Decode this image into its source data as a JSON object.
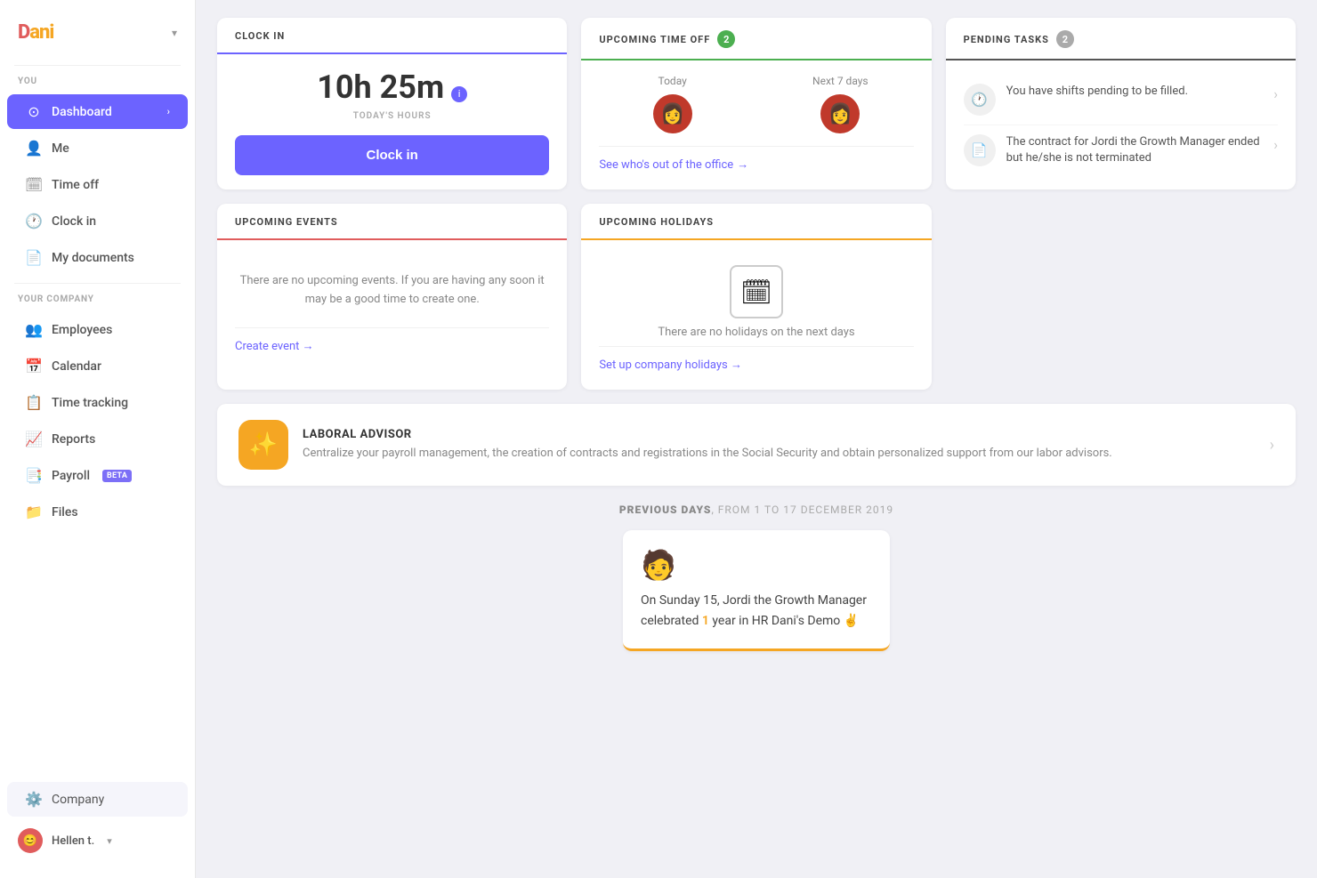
{
  "sidebar": {
    "logo": "Dani",
    "you_label": "YOU",
    "your_company_label": "YOUR COMPANY",
    "items_you": [
      {
        "id": "dashboard",
        "label": "Dashboard",
        "icon": "⊙",
        "active": true
      },
      {
        "id": "me",
        "label": "Me",
        "icon": "👤"
      },
      {
        "id": "time-off",
        "label": "Time off",
        "icon": "🗓"
      },
      {
        "id": "clock-in",
        "label": "Clock in",
        "icon": "🕐"
      },
      {
        "id": "my-documents",
        "label": "My documents",
        "icon": "📄"
      }
    ],
    "items_company": [
      {
        "id": "employees",
        "label": "Employees",
        "icon": "👥"
      },
      {
        "id": "calendar",
        "label": "Calendar",
        "icon": "📅"
      },
      {
        "id": "time-tracking",
        "label": "Time tracking",
        "icon": "📋"
      },
      {
        "id": "reports",
        "label": "Reports",
        "icon": "📈"
      },
      {
        "id": "payroll",
        "label": "Payroll",
        "icon": "📑",
        "beta": true
      },
      {
        "id": "files",
        "label": "Files",
        "icon": "📁"
      }
    ],
    "company_label": "Company",
    "user_name": "Hellen t.",
    "user_avatar": "😊"
  },
  "clock_in_card": {
    "title": "CLOCK IN",
    "hours_value": "10h 25m",
    "hours_icon": "i",
    "hours_label": "TODAY'S HOURS",
    "button_label": "Clock in"
  },
  "time_off_card": {
    "title": "UPCOMING TIME OFF",
    "badge": "2",
    "today_label": "Today",
    "next7_label": "Next 7 days",
    "see_who_label": "See who's out of the office",
    "today_avatar": "👩",
    "next7_avatar": "👩"
  },
  "pending_tasks_card": {
    "title": "PENDING TASKS",
    "badge": "2",
    "tasks": [
      {
        "icon": "🕐",
        "text": "You have shifts pending to be filled."
      },
      {
        "icon": "📄",
        "text": "The contract for Jordi the Growth Manager ended but he/she is not terminated"
      }
    ]
  },
  "upcoming_events_card": {
    "title": "UPCOMING EVENTS",
    "empty_text": "There are no upcoming events. If you are having any soon it may be a good time to create one.",
    "create_link": "Create event →"
  },
  "upcoming_holidays_card": {
    "title": "UPCOMING HOLIDAYS",
    "empty_text": "There are no holidays on the next days",
    "setup_link": "Set up company holidays →"
  },
  "advisor_card": {
    "icon": "✨",
    "title": "LABORAL ADVISOR",
    "description": "Centralize your payroll management, the creation of contracts and registrations in the Social Security and obtain personalized support from our labor advisors."
  },
  "previous_days": {
    "label": "PREVIOUS DAYS",
    "sublabel": ", FROM 1 TO 17 DECEMBER 2019",
    "story": {
      "avatar": "🧑",
      "text": "On Sunday 15, Jordi the Growth Manager celebrated 1 year in HR Dani's Demo ✌️",
      "highlight": "1"
    }
  }
}
